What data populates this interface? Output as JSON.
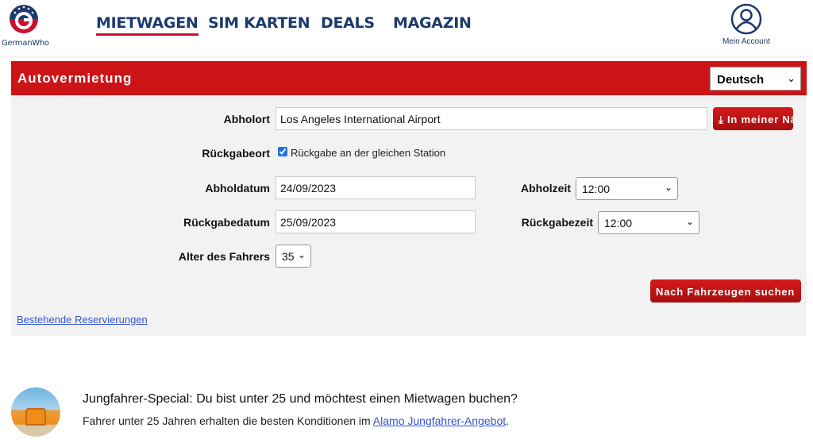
{
  "header": {
    "logo_text": "GermanWho",
    "nav": [
      "MIETWAGEN",
      "SIM KARTEN",
      "DEALS",
      "MAGAZIN"
    ],
    "account_label": "Mein Account"
  },
  "form": {
    "title": "Autovermietung",
    "language": "Deutsch",
    "pickup_label": "Abholort",
    "pickup_value": "Los Angeles International Airport",
    "nearby_button": "In meiner Nähe",
    "return_label": "Rückgabeort",
    "same_station_label": "Rückgabe an der gleichen Station",
    "same_station_checked": true,
    "pickup_date_label": "Abholdatum",
    "pickup_date": "24/09/2023",
    "pickup_time_label": "Abholzeit",
    "pickup_time": "12:00",
    "return_date_label": "Rückgabedatum",
    "return_date": "25/09/2023",
    "return_time_label": "Rückgabezeit",
    "return_time": "12:00",
    "age_label": "Alter des Fahrers",
    "age": "35",
    "search_button": "Nach Fahrzeugen suchen",
    "existing_link": "Bestehende Reservierungen"
  },
  "promo": {
    "title": "Jungfahrer-Special: Du bist unter 25 und möchtest einen Mietwagen buchen?",
    "text": "Fahrer unter 25 Jahren erhalten die besten Konditionen im ",
    "link": "Alamo Jungfahrer-Angebot",
    "after": "."
  },
  "colors": {
    "brand_red": "#cc1417",
    "navy": "#1c3a6b"
  }
}
